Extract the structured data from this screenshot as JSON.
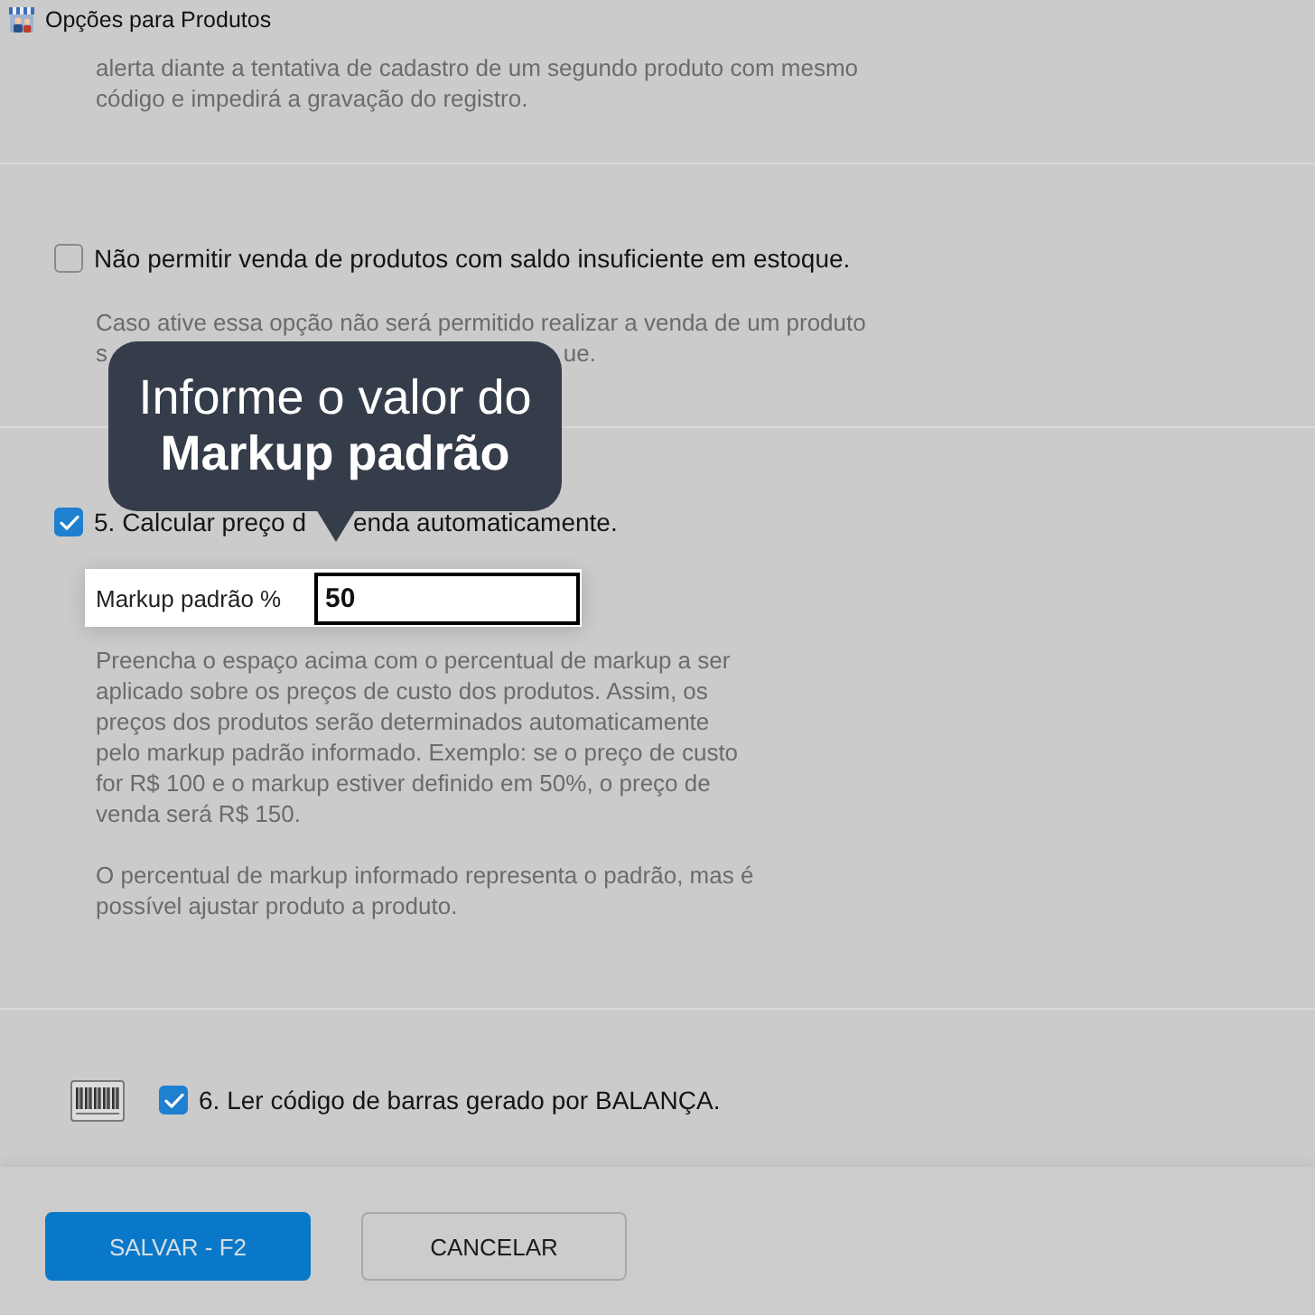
{
  "window": {
    "title": "Opções para Produtos"
  },
  "sections": [
    {
      "kind": "note",
      "description": [
        "alerta diante a tentativa de cadastro de um segundo produto com mesmo código e impedirá a gravação do registro."
      ]
    },
    {
      "kind": "checkbox",
      "checked": false,
      "label_parts": [
        "Não permitir venda de produtos com saldo insuficiente em estoque."
      ],
      "description": [
        "Caso ative essa opção não será permitido realizar a venda de um produto"
      ],
      "covered_line": [
        "s",
        "ue."
      ]
    },
    {
      "kind": "checkbox",
      "checked": true,
      "label_parts": [
        "5. Calcular preço d",
        "enda automaticamente."
      ],
      "field": {
        "label": "Markup padrão %",
        "value": "50"
      },
      "description": [
        "Preencha o espaço acima com o percentual de markup a ser aplicado sobre os preços de custo dos produtos. Assim, os preços dos produtos serão determinados automaticamente pelo markup padrão informado. Exemplo: se o preço de custo for R$ 100 e o markup estiver definido em 50%, o preço de venda será R$ 150.",
        "O percentual de markup informado representa o padrão, mas é possível ajustar produto a produto."
      ]
    },
    {
      "kind": "barcode_checkbox",
      "checked": true,
      "label_parts": [
        "6. Ler código de barras gerado por BALANÇA."
      ]
    }
  ],
  "tooltip": {
    "text": "Informe o valor do **Markup padrão**"
  },
  "buttons": [
    {
      "kind": "primary",
      "label": "SALVAR - F2"
    },
    {
      "kind": "secondary",
      "label": "CANCELAR"
    }
  ]
}
